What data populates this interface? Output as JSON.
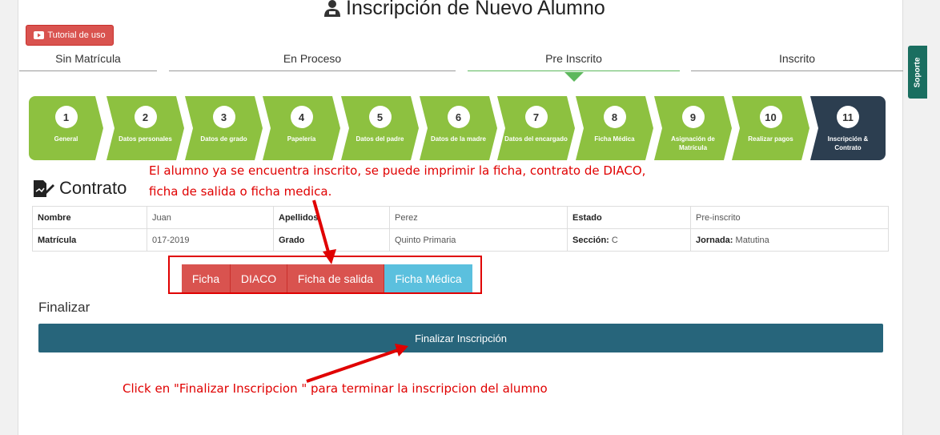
{
  "header": {
    "title": "Inscripción de Nuevo Alumno",
    "tutorial_label": "Tutorial de uso"
  },
  "stages": [
    "Sin Matrícula",
    "En Proceso",
    "Pre Inscrito",
    "Inscrito"
  ],
  "active_stage": "Pre Inscrito",
  "steps": [
    {
      "num": "1",
      "label": "General"
    },
    {
      "num": "2",
      "label": "Datos personales"
    },
    {
      "num": "3",
      "label": "Datos de grado"
    },
    {
      "num": "4",
      "label": "Papelería"
    },
    {
      "num": "5",
      "label": "Datos del padre"
    },
    {
      "num": "6",
      "label": "Datos de la madre"
    },
    {
      "num": "7",
      "label": "Datos del encargado"
    },
    {
      "num": "8",
      "label": "Ficha Médica"
    },
    {
      "num": "9",
      "label": "Asignación de Matrícula"
    },
    {
      "num": "10",
      "label": "Realizar pagos"
    },
    {
      "num": "11",
      "label": "Inscripción & Contrato"
    }
  ],
  "active_step": "11",
  "section": {
    "title": "Contrato"
  },
  "info": {
    "nombre_label": "Nombre",
    "nombre": "Juan",
    "apellidos_label": "Apellidos",
    "apellidos": "Perez",
    "estado_label": "Estado",
    "estado": "Pre-inscrito",
    "matricula_label": "Matrícula",
    "matricula": "017-2019",
    "grado_label": "Grado",
    "grado": "Quinto Primaria",
    "seccion_label": "Sección:",
    "seccion": "C",
    "jornada_label": "Jornada:",
    "jornada": "Matutina"
  },
  "buttons": {
    "ficha": "Ficha",
    "diaco": "DIACO",
    "ficha_salida": "Ficha de salida",
    "ficha_medica": "Ficha Médica"
  },
  "finalizar": {
    "label": "Finalizar",
    "button": "Finalizar Inscripción"
  },
  "annotations": {
    "note1_line1": "El alumno ya se encuentra inscrito, se puede imprimir la ficha, contrato de DIACO,",
    "note1_line2": "ficha de salida o ficha medica.",
    "note2": "Click en \"Finalizar Inscripcion \" para terminar la inscripcion del alumno"
  },
  "side_tab": "Soporte",
  "colors": {
    "step_green": "#8dc140",
    "step_active": "#2c3e50",
    "danger": "#d9534f",
    "info": "#5bc0de",
    "primary_dark": "#27657b",
    "annotation_red": "#e00000"
  }
}
